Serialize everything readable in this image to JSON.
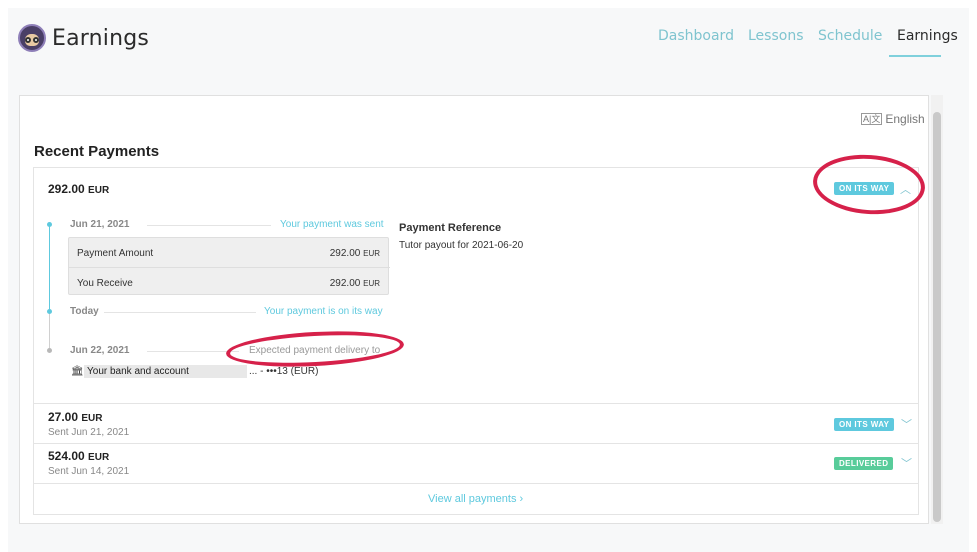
{
  "header": {
    "title": "Earnings",
    "nav": [
      "Dashboard",
      "Lessons",
      "Schedule",
      "Earnings"
    ],
    "active_tab": "Earnings"
  },
  "language": {
    "icon": "translate-icon",
    "label": "English"
  },
  "section_title": "Recent Payments",
  "payments": [
    {
      "amount": "292.00",
      "currency": "EUR",
      "status": "ON ITS WAY",
      "expanded": true,
      "timeline": [
        {
          "date": "Jun 21, 2021",
          "message": "Your payment was sent"
        },
        {
          "date": "Today",
          "message": "Your payment is on its way"
        },
        {
          "date": "Jun 22, 2021",
          "message": "Expected payment delivery to"
        }
      ],
      "details": [
        {
          "label": "Payment Amount",
          "value": "292.00",
          "currency": "EUR"
        },
        {
          "label": "You Receive",
          "value": "292.00",
          "currency": "EUR"
        }
      ],
      "reference_title": "Payment Reference",
      "reference": "Tutor payout for 2021-06-20",
      "bank_label": "Your bank and account",
      "bank_suffix": "... - •••13 (EUR)"
    },
    {
      "amount": "27.00",
      "currency": "EUR",
      "sent": "Sent Jun 21, 2021",
      "status": "ON ITS WAY"
    },
    {
      "amount": "524.00",
      "currency": "EUR",
      "sent": "Sent Jun 14, 2021",
      "status": "DELIVERED"
    }
  ],
  "view_all": "View all payments",
  "colors": {
    "accent": "#5ec9de",
    "delivered": "#58cc9a",
    "annotation": "#d6214a"
  },
  "icons": [
    "logo-avatar-icon",
    "translate-icon",
    "chevron-up-icon",
    "chevron-down-icon",
    "bank-icon",
    "chevron-right-icon"
  ]
}
